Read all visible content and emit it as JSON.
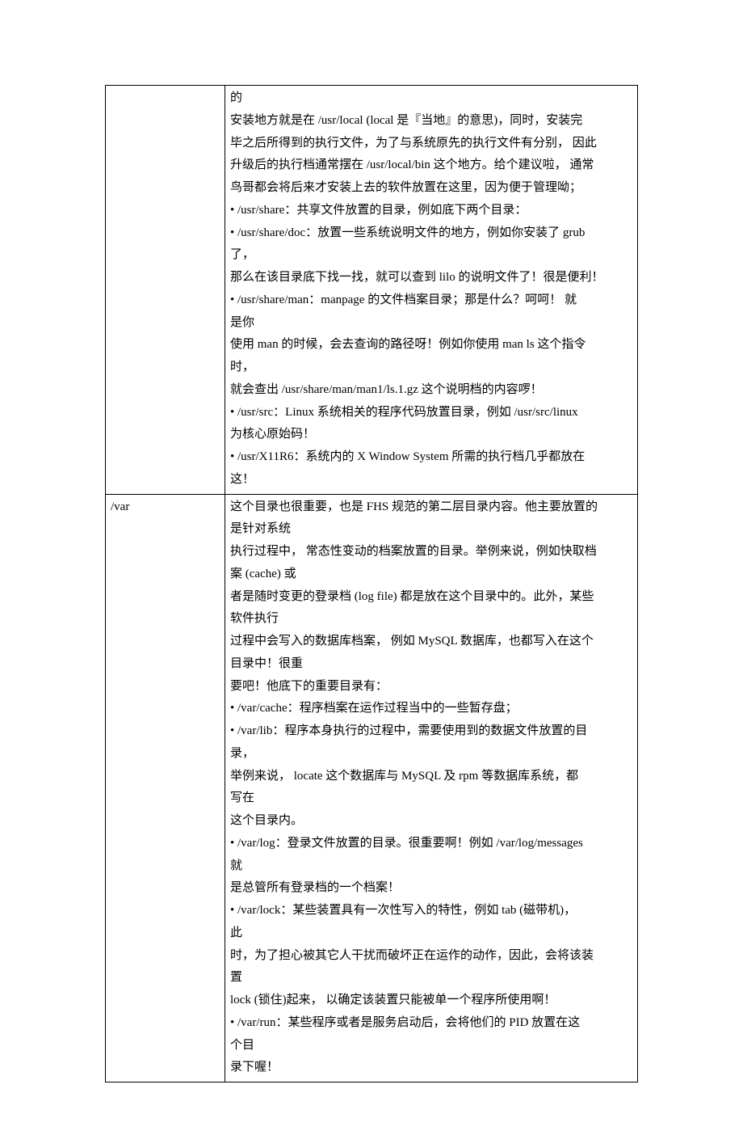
{
  "rows": [
    {
      "label": "",
      "content": [
        "的",
        "安装地方就是在 /usr/local (local 是『当地』的意思)，同时，安装完",
        "毕之后所得到的执行文件，为了与系统原先的执行文件有分别， 因此",
        "升级后的执行档通常摆在 /usr/local/bin 这个地方。给个建议啦， 通常",
        "鸟哥都会将后来才安装上去的软件放置在这里，因为便于管理呦；",
        "• /usr/share：共享文件放置的目录，例如底下两个目录：",
        "• /usr/share/doc：放置一些系统说明文件的地方，例如你安装了 grub",
        "了，",
        "那么在该目录底下找一找，就可以查到 lilo 的说明文件了！很是便利！",
        "• /usr/share/man：manpage 的文件档案目录；那是什么？呵呵！ 就",
        "是你",
        "使用 man 的时候，会去查询的路径呀！例如你使用 man ls 这个指令",
        "时，",
        "就会查出 /usr/share/man/man1/ls.1.gz 这个说明档的内容啰！",
        "• /usr/src：Linux 系统相关的程序代码放置目录，例如 /usr/src/linux",
        "为核心原始码！",
        "• /usr/X11R6：系统内的 X Window System 所需的执行档几乎都放在",
        "这！"
      ]
    },
    {
      "label": "/var",
      "content": [
        "这个目录也很重要，也是 FHS 规范的第二层目录内容。他主要放置的",
        "是针对系统",
        "执行过程中， 常态性变动的档案放置的目录。举例来说，例如快取档",
        "案 (cache) 或",
        "者是随时变更的登录档 (log file) 都是放在这个目录中的。此外，某些",
        "软件执行",
        "过程中会写入的数据库档案， 例如 MySQL 数据库，也都写入在这个",
        "目录中！很重",
        "要吧！他底下的重要目录有：",
        "• /var/cache：程序档案在运作过程当中的一些暂存盘；",
        "• /var/lib：程序本身执行的过程中，需要使用到的数据文件放置的目",
        "录，",
        "举例来说， locate 这个数据库与 MySQL 及 rpm 等数据库系统，都",
        "写在",
        "这个目录内。",
        "• /var/log：登录文件放置的目录。很重要啊！例如 /var/log/messages",
        "就",
        "是总管所有登录档的一个档案！",
        "• /var/lock：某些装置具有一次性写入的特性，例如 tab (磁带机)，",
        "此",
        "时，为了担心被其它人干扰而破坏正在运作的动作，因此，会将该装",
        "置",
        "lock (锁住)起来， 以确定该装置只能被单一个程序所使用啊！",
        "• /var/run：某些程序或者是服务启动后，会将他们的 PID 放置在这",
        "个目",
        "录下喔！"
      ]
    }
  ]
}
